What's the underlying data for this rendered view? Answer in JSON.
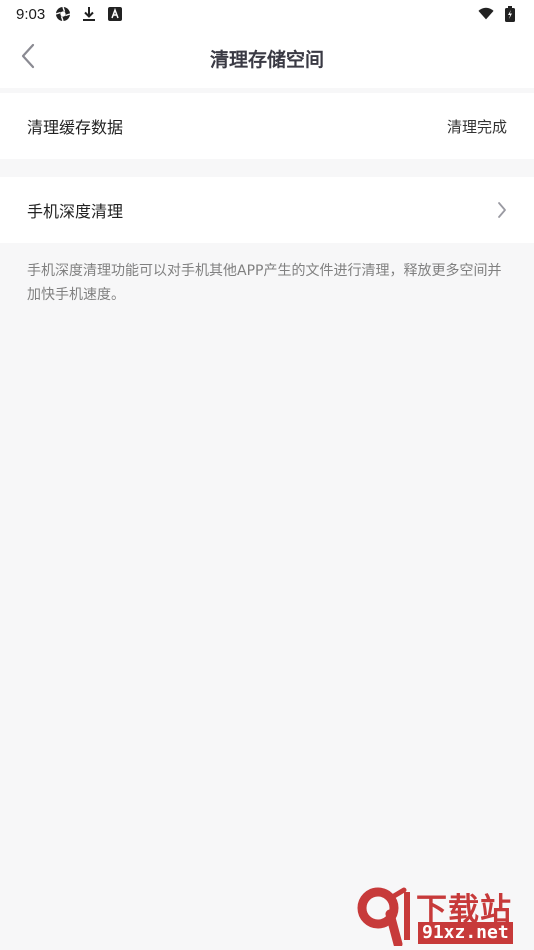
{
  "status_bar": {
    "time": "9:03",
    "icons_left": [
      "aperture-icon",
      "download-icon",
      "font-icon"
    ],
    "icons_right": [
      "wifi-icon",
      "battery-icon"
    ]
  },
  "header": {
    "title": "清理存储空间",
    "back_icon": "chevron-left-icon"
  },
  "settings": {
    "cache": {
      "label": "清理缓存数据",
      "value": "清理完成"
    },
    "deep_clean": {
      "label": "手机深度清理",
      "icon": "chevron-right-icon"
    },
    "description": "手机深度清理功能可以对手机其他APP产生的文件进行清理，释放更多空间并加快手机速度。"
  },
  "watermark": {
    "title": "下载站",
    "domain": "91xz.net",
    "color": "#c73a3a"
  },
  "colors": {
    "background": "#f7f7f8",
    "card": "#ffffff",
    "title": "#3a3a44",
    "muted": "#808080"
  }
}
